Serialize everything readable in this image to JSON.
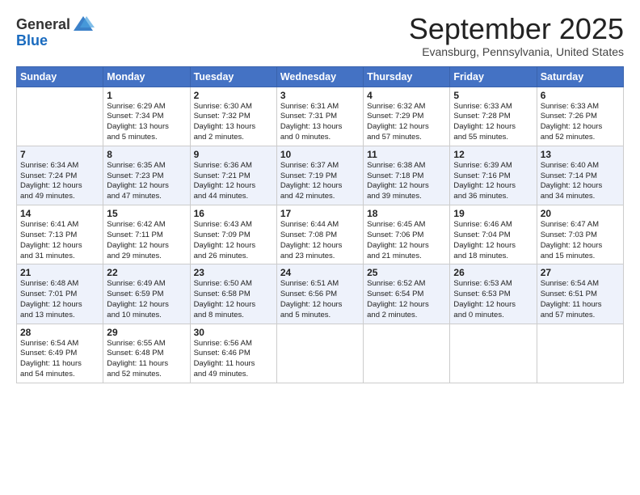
{
  "header": {
    "logo_line1": "General",
    "logo_line2": "Blue",
    "month": "September 2025",
    "location": "Evansburg, Pennsylvania, United States"
  },
  "weekdays": [
    "Sunday",
    "Monday",
    "Tuesday",
    "Wednesday",
    "Thursday",
    "Friday",
    "Saturday"
  ],
  "weeks": [
    [
      {
        "day": "",
        "info": ""
      },
      {
        "day": "1",
        "info": "Sunrise: 6:29 AM\nSunset: 7:34 PM\nDaylight: 13 hours\nand 5 minutes."
      },
      {
        "day": "2",
        "info": "Sunrise: 6:30 AM\nSunset: 7:32 PM\nDaylight: 13 hours\nand 2 minutes."
      },
      {
        "day": "3",
        "info": "Sunrise: 6:31 AM\nSunset: 7:31 PM\nDaylight: 13 hours\nand 0 minutes."
      },
      {
        "day": "4",
        "info": "Sunrise: 6:32 AM\nSunset: 7:29 PM\nDaylight: 12 hours\nand 57 minutes."
      },
      {
        "day": "5",
        "info": "Sunrise: 6:33 AM\nSunset: 7:28 PM\nDaylight: 12 hours\nand 55 minutes."
      },
      {
        "day": "6",
        "info": "Sunrise: 6:33 AM\nSunset: 7:26 PM\nDaylight: 12 hours\nand 52 minutes."
      }
    ],
    [
      {
        "day": "7",
        "info": "Sunrise: 6:34 AM\nSunset: 7:24 PM\nDaylight: 12 hours\nand 49 minutes."
      },
      {
        "day": "8",
        "info": "Sunrise: 6:35 AM\nSunset: 7:23 PM\nDaylight: 12 hours\nand 47 minutes."
      },
      {
        "day": "9",
        "info": "Sunrise: 6:36 AM\nSunset: 7:21 PM\nDaylight: 12 hours\nand 44 minutes."
      },
      {
        "day": "10",
        "info": "Sunrise: 6:37 AM\nSunset: 7:19 PM\nDaylight: 12 hours\nand 42 minutes."
      },
      {
        "day": "11",
        "info": "Sunrise: 6:38 AM\nSunset: 7:18 PM\nDaylight: 12 hours\nand 39 minutes."
      },
      {
        "day": "12",
        "info": "Sunrise: 6:39 AM\nSunset: 7:16 PM\nDaylight: 12 hours\nand 36 minutes."
      },
      {
        "day": "13",
        "info": "Sunrise: 6:40 AM\nSunset: 7:14 PM\nDaylight: 12 hours\nand 34 minutes."
      }
    ],
    [
      {
        "day": "14",
        "info": "Sunrise: 6:41 AM\nSunset: 7:13 PM\nDaylight: 12 hours\nand 31 minutes."
      },
      {
        "day": "15",
        "info": "Sunrise: 6:42 AM\nSunset: 7:11 PM\nDaylight: 12 hours\nand 29 minutes."
      },
      {
        "day": "16",
        "info": "Sunrise: 6:43 AM\nSunset: 7:09 PM\nDaylight: 12 hours\nand 26 minutes."
      },
      {
        "day": "17",
        "info": "Sunrise: 6:44 AM\nSunset: 7:08 PM\nDaylight: 12 hours\nand 23 minutes."
      },
      {
        "day": "18",
        "info": "Sunrise: 6:45 AM\nSunset: 7:06 PM\nDaylight: 12 hours\nand 21 minutes."
      },
      {
        "day": "19",
        "info": "Sunrise: 6:46 AM\nSunset: 7:04 PM\nDaylight: 12 hours\nand 18 minutes."
      },
      {
        "day": "20",
        "info": "Sunrise: 6:47 AM\nSunset: 7:03 PM\nDaylight: 12 hours\nand 15 minutes."
      }
    ],
    [
      {
        "day": "21",
        "info": "Sunrise: 6:48 AM\nSunset: 7:01 PM\nDaylight: 12 hours\nand 13 minutes."
      },
      {
        "day": "22",
        "info": "Sunrise: 6:49 AM\nSunset: 6:59 PM\nDaylight: 12 hours\nand 10 minutes."
      },
      {
        "day": "23",
        "info": "Sunrise: 6:50 AM\nSunset: 6:58 PM\nDaylight: 12 hours\nand 8 minutes."
      },
      {
        "day": "24",
        "info": "Sunrise: 6:51 AM\nSunset: 6:56 PM\nDaylight: 12 hours\nand 5 minutes."
      },
      {
        "day": "25",
        "info": "Sunrise: 6:52 AM\nSunset: 6:54 PM\nDaylight: 12 hours\nand 2 minutes."
      },
      {
        "day": "26",
        "info": "Sunrise: 6:53 AM\nSunset: 6:53 PM\nDaylight: 12 hours\nand 0 minutes."
      },
      {
        "day": "27",
        "info": "Sunrise: 6:54 AM\nSunset: 6:51 PM\nDaylight: 11 hours\nand 57 minutes."
      }
    ],
    [
      {
        "day": "28",
        "info": "Sunrise: 6:54 AM\nSunset: 6:49 PM\nDaylight: 11 hours\nand 54 minutes."
      },
      {
        "day": "29",
        "info": "Sunrise: 6:55 AM\nSunset: 6:48 PM\nDaylight: 11 hours\nand 52 minutes."
      },
      {
        "day": "30",
        "info": "Sunrise: 6:56 AM\nSunset: 6:46 PM\nDaylight: 11 hours\nand 49 minutes."
      },
      {
        "day": "",
        "info": ""
      },
      {
        "day": "",
        "info": ""
      },
      {
        "day": "",
        "info": ""
      },
      {
        "day": "",
        "info": ""
      }
    ]
  ]
}
